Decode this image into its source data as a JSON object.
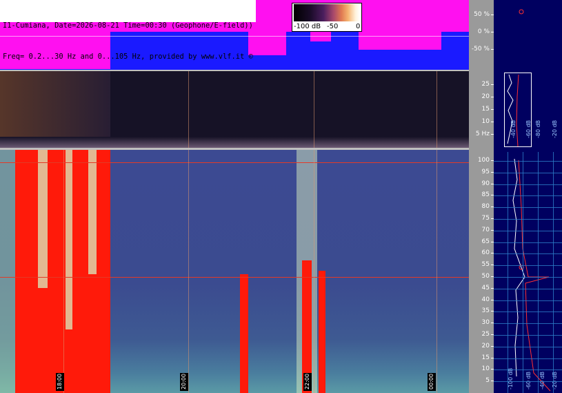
{
  "header": {
    "title_line1": "I1-Cumiana, Date=2026-08-21 Time=00:30 (Geophone/E-field))",
    "title_line2": "Freq= 0.2...30 Hz and 0...105 Hz, provided by www.vlf.it ©"
  },
  "legend": {
    "min_label": "-100 dB",
    "mid_label": "-50",
    "max_label": "0"
  },
  "top_axis": {
    "labels": [
      "50 %",
      "0 %",
      "-50 %"
    ]
  },
  "mid_axis": {
    "labels": [
      "25",
      "20",
      "15",
      "10",
      "5 Hz"
    ]
  },
  "bottom_axis": {
    "labels": [
      "100",
      "95",
      "90",
      "85",
      "80",
      "75",
      "70",
      "65",
      "60",
      "55",
      "50",
      "45",
      "40",
      "35",
      "30",
      "25",
      "20",
      "15",
      "10",
      "5"
    ]
  },
  "time_labels": [
    "18:00",
    "20:00",
    "22:00",
    "00:00"
  ],
  "right_panel": {
    "mid_scale_labels": [
      "-40 dB",
      "-60 dB",
      "-80 dB",
      "-20 dB"
    ],
    "bottom_scale_labels": [
      "-100 dB",
      "-60 dB",
      "-40 dB",
      "-20 dB"
    ]
  },
  "colors": {
    "accent_red": "#ff1a0a",
    "panel_blue": "#000060",
    "magenta": "#ff10f0"
  }
}
